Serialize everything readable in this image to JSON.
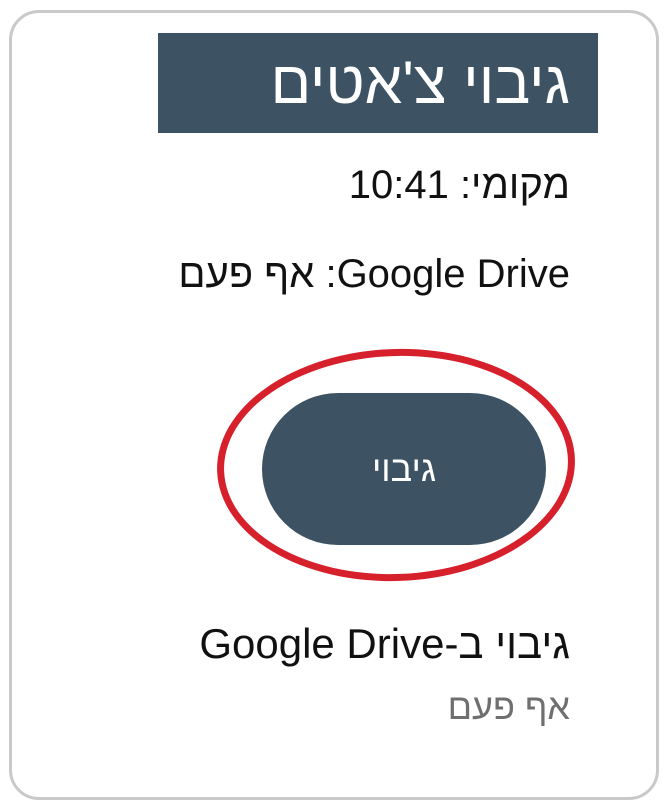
{
  "header": {
    "title": "גיבוי צ'אטים"
  },
  "status": {
    "local_time": "מקומי: 10:41",
    "google_drive": "Google Drive: אף פעם"
  },
  "backup_button": {
    "label": "גיבוי"
  },
  "drive_setting": {
    "title": "גיבוי ב-Google Drive",
    "value": "אף פעם"
  },
  "colors": {
    "accent": "#3d5363",
    "highlight": "#d6202b",
    "border": "#c9c9c9"
  }
}
